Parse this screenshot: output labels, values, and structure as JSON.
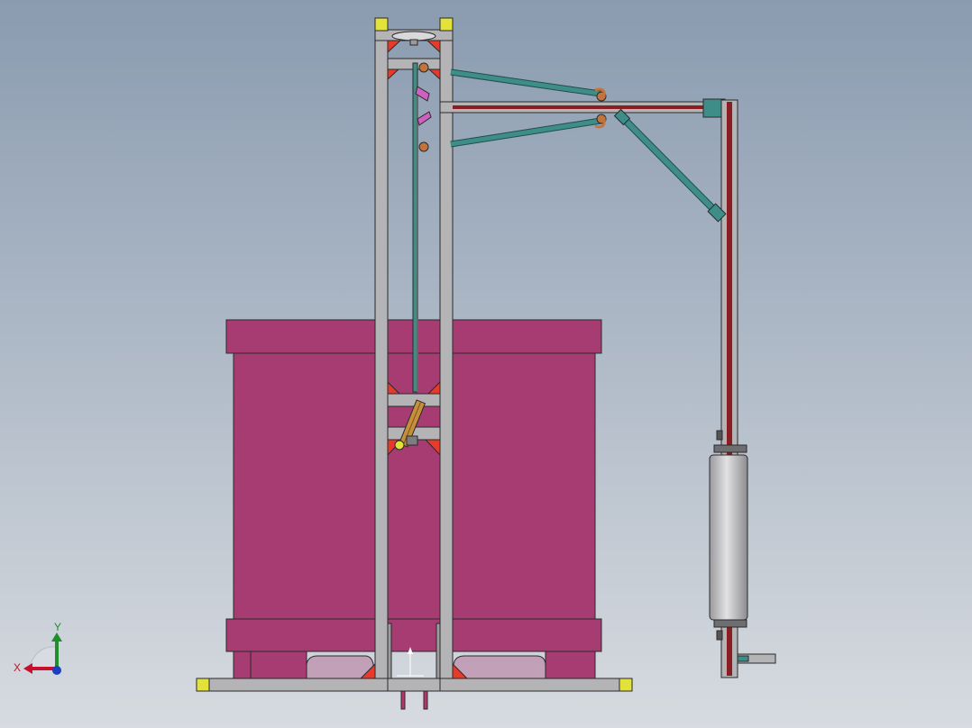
{
  "viewport": {
    "background_top": "#8a9bb0",
    "background_bottom": "#d7dbe0",
    "view": "front"
  },
  "colors": {
    "frame_fill": "#b4b4b6",
    "frame_stroke": "#2a2a2a",
    "corner_cap": "#e2e23a",
    "gusset": "#e63b2a",
    "tank": "#a63c72",
    "tank_dark": "#8e2f60",
    "rail": "#8b1e22",
    "strut": "#3f8d88",
    "pivot": "#c4733d",
    "roller": "#b8b8bc",
    "cylinder": "#c58f3c",
    "leg": "#b8346a",
    "clip": "#d060c0"
  },
  "icons": {
    "triad": "axis-triad-icon"
  },
  "triad": {
    "x_label": "X",
    "y_label": "Y",
    "x_color": "#c8102e",
    "y_color": "#1e8f2a",
    "z_color": "#1a3fbf"
  }
}
